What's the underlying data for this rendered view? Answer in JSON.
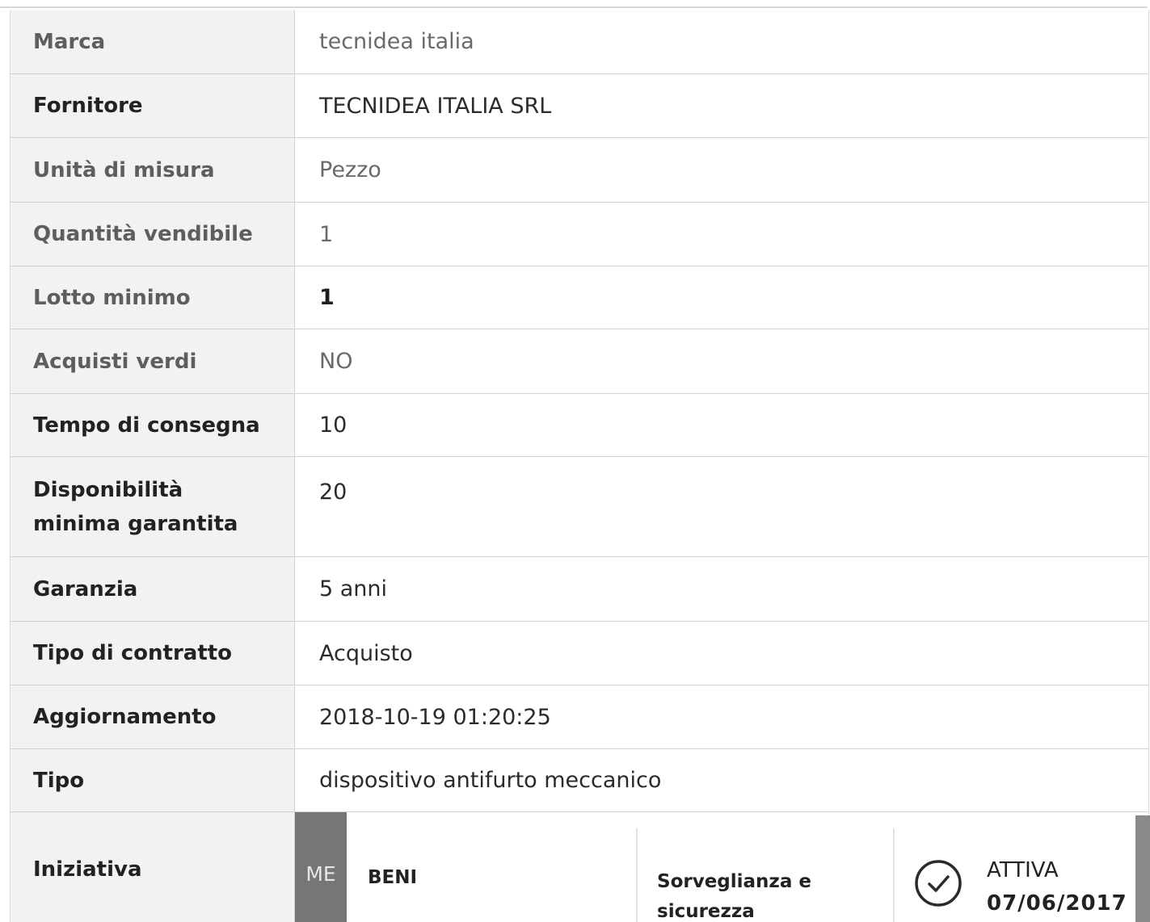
{
  "rows": [
    {
      "label": "Marca",
      "value": "tecnidea italia"
    },
    {
      "label": "Fornitore",
      "value": "TECNIDEA ITALIA SRL"
    },
    {
      "label": "Unità di misura",
      "value": "Pezzo"
    },
    {
      "label": "Quantità vendibile",
      "value": "1"
    },
    {
      "label": "Lotto minimo",
      "value": "1"
    },
    {
      "label": "Acquisti verdi",
      "value": "NO"
    },
    {
      "label": "Tempo di consegna",
      "value": "10"
    },
    {
      "label": "Disponibilità minima garantita",
      "value": "20"
    },
    {
      "label": "Garanzia",
      "value": "5 anni"
    },
    {
      "label": "Tipo di contratto",
      "value": "Acquisto"
    },
    {
      "label": "Aggiornamento",
      "value": "2018-10-19 01:20:25"
    },
    {
      "label": "Tipo",
      "value": "dispositivo antifurto meccanico"
    }
  ],
  "iniziativa": {
    "label": "Iniziativa",
    "badge": "ME",
    "tipo": "BENI",
    "categoria_line1": "Sorveglianza e",
    "categoria_line2": "sicurezza",
    "stato": "ATTIVA",
    "data": "07/06/2017",
    "status_icon": "check-circle-icon"
  },
  "colors": {
    "label_bg": "#f2f2f2",
    "border": "#d2d2d2",
    "badge_bg": "#767676"
  }
}
